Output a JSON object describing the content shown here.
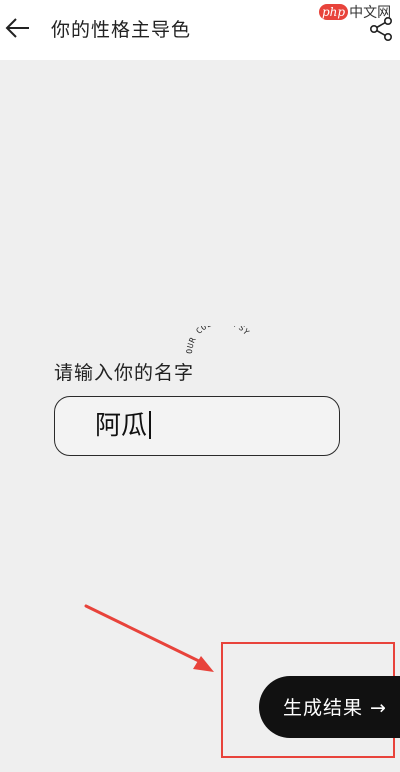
{
  "header": {
    "title": "你的性格主导色",
    "back_icon": "arrow-left-icon",
    "share_icon": "share-icon"
  },
  "watermark": {
    "badge": "php",
    "text": "中文网"
  },
  "form": {
    "label": "请输入你的名字",
    "name_value": "阿瓜",
    "decor_text": "OUR COLORS-PSY"
  },
  "action": {
    "generate_label": "生成结果 →"
  },
  "colors": {
    "background": "#efefef",
    "header_bg": "#ffffff",
    "button_bg": "#111111",
    "annotation_red": "#e8433b"
  }
}
